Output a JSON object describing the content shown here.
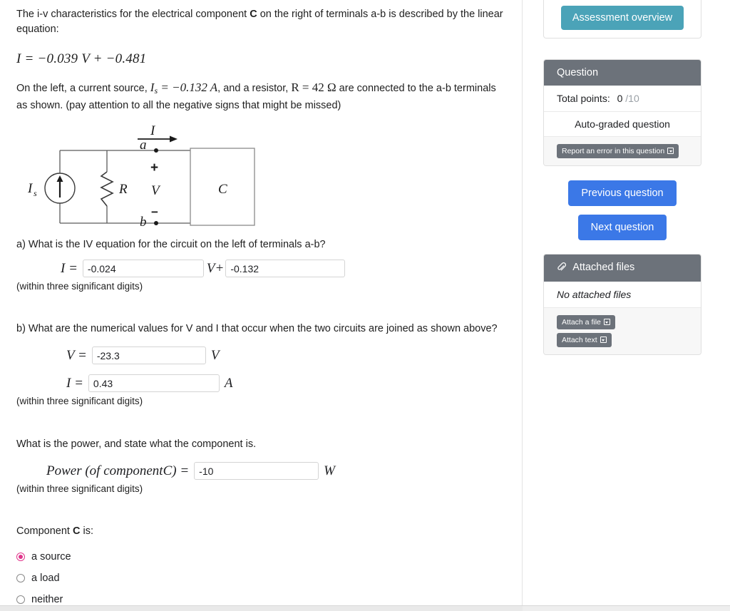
{
  "question": {
    "intro_line1": "The i-v characteristics for the electrical component ",
    "intro_bold_c": "C",
    "intro_line1_rest": " on the right of terminals a-b is described by the linear equation:",
    "equation": "I = −0.039 V + −0.481",
    "equation_parts": {
      "lhs": "I",
      "eq": "=",
      "slope": "−0.039",
      "var": "V",
      "plus": "+",
      "intercept": "−0.481"
    },
    "intro_line2_a": "On the left, a current source, ",
    "current_source_expr": "I",
    "current_source_sub": "s",
    "current_source_value": " = −0.132 A",
    "intro_line2_b": ", and a resistor, ",
    "resistor_expr": "R = 42 Ω",
    "intro_line2_c": " are connected to the a-b terminals as shown. (pay attention to all the negative signs that might be missed)"
  },
  "circuit": {
    "label_current_source": "I",
    "label_current_source_sub": "s",
    "label_resistor": "R",
    "label_current": "I",
    "label_terminal_a": "a",
    "label_terminal_b": "b",
    "label_plus": "+",
    "label_minus": "−",
    "label_voltage": "V",
    "label_component": "C"
  },
  "part_a": {
    "prompt": "a) What is the IV equation for the circuit on the left of terminals a-b?",
    "lead": "I =",
    "slope_value": "-0.024",
    "middle": "V+",
    "intercept_value": "-0.132",
    "hint": "(within three significant digits)"
  },
  "part_b": {
    "prompt": "b) What are the numerical values for V and I that occur when the two circuits are joined as shown above?",
    "v_lead": "V =",
    "v_value": "-23.3",
    "v_unit": "V",
    "i_lead": "I =",
    "i_value": "0.43",
    "i_unit": "A",
    "hint": "(within three significant digits)"
  },
  "part_power": {
    "prompt": "What is the power, and state what the component is.",
    "lead": "Power (of componentC) =",
    "value": "-10",
    "unit": "W",
    "hint": "(within three significant digits)"
  },
  "part_component": {
    "prompt_pre": "Component ",
    "prompt_bold": "C",
    "prompt_post": " is:",
    "options": [
      {
        "label": "a source",
        "selected": true
      },
      {
        "label": "a load",
        "selected": false
      },
      {
        "label": "neither",
        "selected": false
      }
    ]
  },
  "sidebar": {
    "assessment_overview_label": "Assessment overview",
    "question_card": {
      "title": "Question",
      "total_points_label": "Total points:",
      "points_earned": "0",
      "points_total": "/10",
      "auto_graded_label": "Auto-graded question",
      "report_error_label": "Report an error in this question"
    },
    "previous_question_label": "Previous question",
    "next_question_label": "Next question",
    "attached_files_card": {
      "title": "Attached files",
      "empty_label": "No attached files",
      "attach_file_label": "Attach a file",
      "attach_text_label": "Attach text"
    }
  },
  "colors": {
    "teal": "#4ba3b8",
    "blue": "#3b78e7",
    "grey_header": "#6c727a",
    "radio_selected": "#e0368c"
  }
}
